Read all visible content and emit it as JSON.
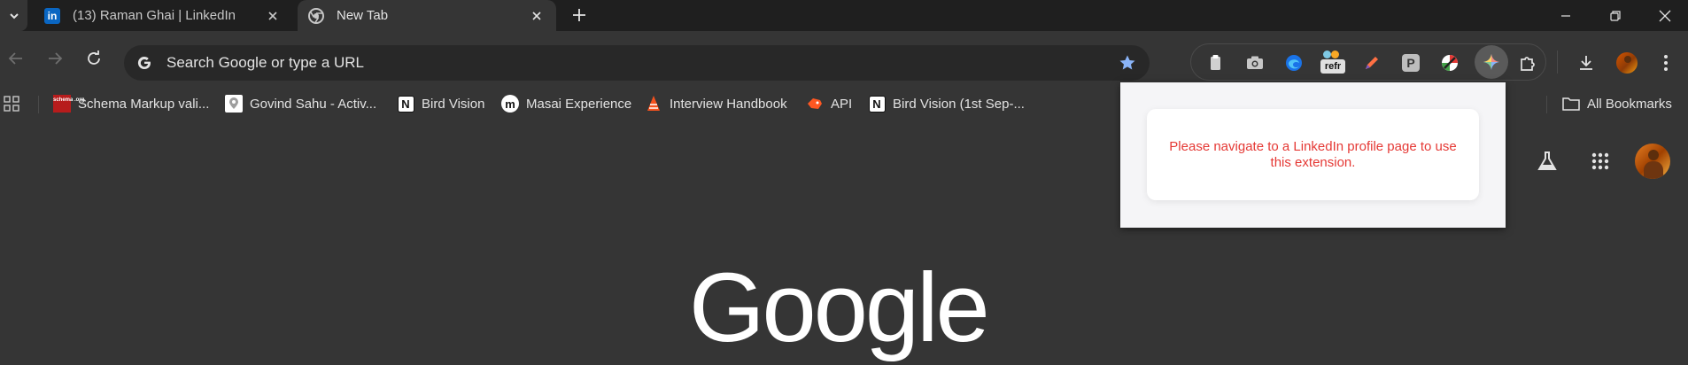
{
  "tabs": [
    {
      "title": "(13) Raman Ghai | LinkedIn",
      "favicon": "linkedin-icon",
      "active": false
    },
    {
      "title": "New Tab",
      "favicon": "chrome-icon",
      "active": true
    }
  ],
  "omnibox": {
    "placeholder": "Search Google or type a URL"
  },
  "extensions": [
    {
      "name": "clipboard-extension-icon"
    },
    {
      "name": "camera-extension-icon"
    },
    {
      "name": "edge-extension-icon"
    },
    {
      "name": "refr-extension-icon",
      "label": "refr"
    },
    {
      "name": "pen-extension-icon"
    },
    {
      "name": "p-extension-icon",
      "label": "P"
    },
    {
      "name": "color-slash-extension-icon"
    },
    {
      "name": "gemini-extension-icon"
    }
  ],
  "bookmarks": [
    {
      "label": "Schema Markup vali...",
      "icon": "schema-icon",
      "icon_text": "schema .org"
    },
    {
      "label": "Govind Sahu - Activ...",
      "icon": "map-pin-icon"
    },
    {
      "label": "Bird Vision",
      "icon": "notion-icon"
    },
    {
      "label": "Masai Experience",
      "icon": "masai-icon"
    },
    {
      "label": "Interview Handbook",
      "icon": "cone-icon"
    },
    {
      "label": "API",
      "icon": "api-icon"
    },
    {
      "label": "Bird Vision (1st Sep-...",
      "icon": "notion-icon"
    }
  ],
  "all_bookmarks": "All Bookmarks",
  "popup": {
    "message": "Please navigate to a LinkedIn profile page to use this extension."
  },
  "logo": {
    "text": "Google"
  },
  "colors": {
    "error_text": "#e53935",
    "linkedin_blue": "#0a66c2",
    "star_blue": "#8ab4f8"
  }
}
